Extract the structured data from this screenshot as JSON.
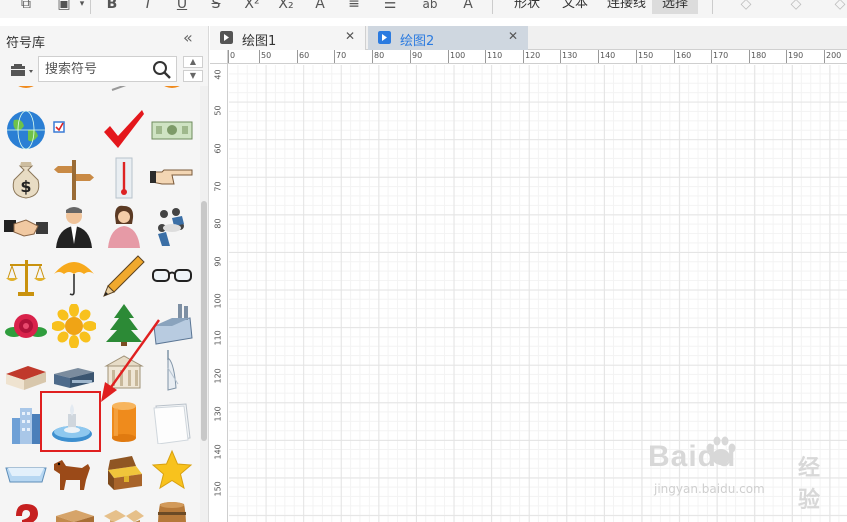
{
  "toolbar": {
    "partial_labels": [
      "形状",
      "文本",
      "连接线",
      "选择"
    ]
  },
  "symbol_library": {
    "title": "符号库",
    "search_placeholder": "搜索符号",
    "symbols": [
      {
        "name": "globe",
        "row": 0,
        "col": 0
      },
      {
        "name": "checkbox",
        "row": 0,
        "col": 1
      },
      {
        "name": "check-mark",
        "row": 0,
        "col": 2
      },
      {
        "name": "banknote",
        "row": 0,
        "col": 3
      },
      {
        "name": "money-bag",
        "row": 1,
        "col": 0
      },
      {
        "name": "signpost",
        "row": 1,
        "col": 1
      },
      {
        "name": "thermometer",
        "row": 1,
        "col": 2
      },
      {
        "name": "pointing-hand",
        "row": 1,
        "col": 3
      },
      {
        "name": "handshake",
        "row": 2,
        "col": 0
      },
      {
        "name": "businessman",
        "row": 2,
        "col": 1
      },
      {
        "name": "businesswoman",
        "row": 2,
        "col": 2
      },
      {
        "name": "meeting-group",
        "row": 2,
        "col": 3
      },
      {
        "name": "balance-scale",
        "row": 3,
        "col": 0
      },
      {
        "name": "umbrella",
        "row": 3,
        "col": 1
      },
      {
        "name": "pencil",
        "row": 3,
        "col": 2
      },
      {
        "name": "glasses",
        "row": 3,
        "col": 3
      },
      {
        "name": "rose",
        "row": 4,
        "col": 0
      },
      {
        "name": "sunflower",
        "row": 4,
        "col": 1
      },
      {
        "name": "pine-tree",
        "row": 4,
        "col": 2
      },
      {
        "name": "factory",
        "row": 4,
        "col": 3
      },
      {
        "name": "warehouse",
        "row": 5,
        "col": 0
      },
      {
        "name": "industrial-plant",
        "row": 5,
        "col": 1
      },
      {
        "name": "bank-building",
        "row": 5,
        "col": 2
      },
      {
        "name": "tower-hotel",
        "row": 5,
        "col": 3
      },
      {
        "name": "office-buildings",
        "row": 6,
        "col": 0
      },
      {
        "name": "fountain",
        "row": 6,
        "col": 1
      },
      {
        "name": "cylinder",
        "row": 6,
        "col": 2
      },
      {
        "name": "paper-sheets",
        "row": 6,
        "col": 3
      },
      {
        "name": "tray",
        "row": 7,
        "col": 0
      },
      {
        "name": "dog",
        "row": 7,
        "col": 1
      },
      {
        "name": "treasure-chest",
        "row": 7,
        "col": 2
      },
      {
        "name": "star",
        "row": 7,
        "col": 3
      },
      {
        "name": "question-mark",
        "row": 8,
        "col": 0
      },
      {
        "name": "cardboard-box",
        "row": 8,
        "col": 1
      },
      {
        "name": "open-box",
        "row": 8,
        "col": 2
      },
      {
        "name": "barrel",
        "row": 8,
        "col": 3
      }
    ],
    "highlighted_symbol": "fountain"
  },
  "tabs": [
    {
      "label": "绘图1",
      "active": false
    },
    {
      "label": "绘图2",
      "active": true
    }
  ],
  "ruler": {
    "horizontal": [
      "0",
      "50",
      "60",
      "70",
      "80",
      "90",
      "100",
      "110",
      "120",
      "130",
      "140",
      "150",
      "160",
      "170",
      "180",
      "190",
      "200"
    ],
    "vertical": [
      "40",
      "50",
      "60",
      "70",
      "80",
      "90",
      "100",
      "110",
      "120",
      "130",
      "140",
      "150"
    ]
  },
  "watermark": {
    "brand": "Baidu",
    "brand_suffix": "经验",
    "url": "jingyan.baidu.com"
  },
  "colors": {
    "active_tab_text": "#2b7be0",
    "highlight": "#e02020"
  }
}
